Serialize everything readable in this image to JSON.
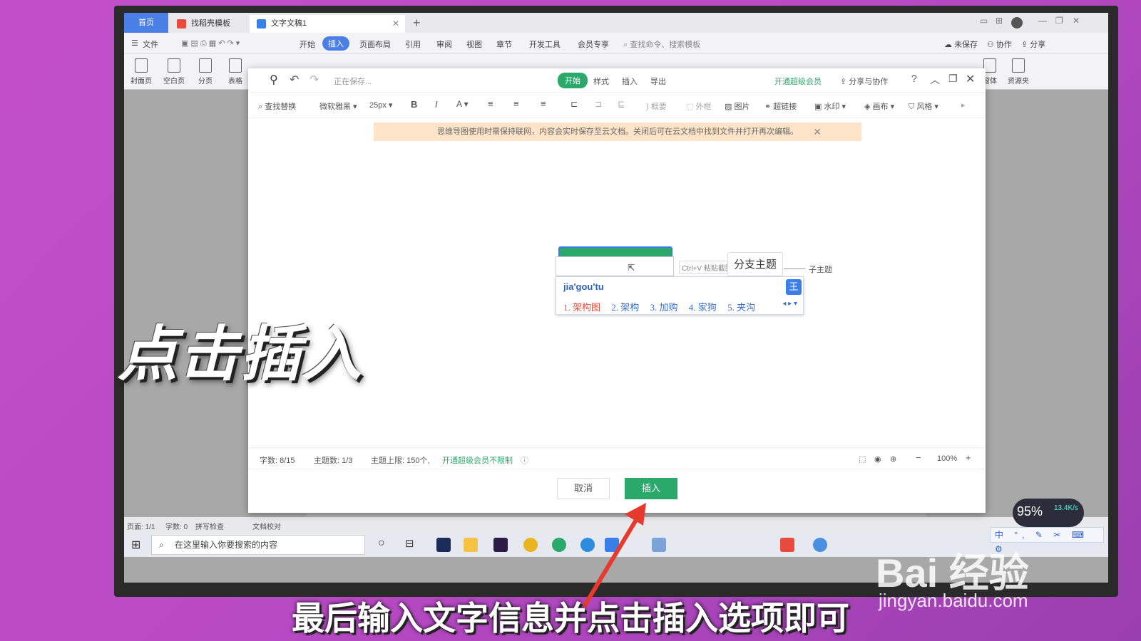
{
  "tabs": [
    {
      "label": "首页"
    },
    {
      "label": "找稻壳模板"
    },
    {
      "label": "文字文稿1"
    }
  ],
  "menu": [
    "文件",
    "开始",
    "插入",
    "页面布局",
    "引用",
    "审阅",
    "视图",
    "章节",
    "开发工具",
    "会员专享"
  ],
  "menu_search": "查找命令、搜索模板",
  "menu_right": [
    "未保存",
    "协作",
    "分享"
  ],
  "ribbon": [
    "封面页",
    "空白页",
    "分页",
    "表格",
    "窗体",
    "资源夹"
  ],
  "dialog": {
    "saving": "正在保存...",
    "tabs": [
      "开始",
      "样式",
      "插入",
      "导出"
    ],
    "member": "开通超级会员",
    "share": "分享与协作",
    "toolbar": {
      "find": "查找替换",
      "font": "微软雅黑",
      "size": "25px",
      "summary": "概要",
      "frame": "外框",
      "image": "图片",
      "link": "超链接",
      "watermark": "水印",
      "canvas": "画布",
      "style": "风格"
    },
    "notice": "思维导图使用时需保持联网，内容会实时保存至云文档。关闭后可在云文档中找到文件并打开再次编辑。",
    "mind": {
      "paste_hint": "Ctrl+V 粘贴截图",
      "branch": "分支主题",
      "sub": "子主题"
    },
    "ime": {
      "input": "jia'gou'tu",
      "logo": "王",
      "candidates": [
        "1. 架构图",
        "2. 架构",
        "3. 加购",
        "4. 家狗",
        "5. 夹沟"
      ]
    },
    "status": {
      "words": "字数: 8/15",
      "topics": "主题数: 1/3",
      "limit": "主题上限: 150个,",
      "upgrade": "开通超级会员不限制",
      "zoom": "100%"
    },
    "cancel": "取消",
    "insert": "插入"
  },
  "statusbar": [
    "页面: 1/1",
    "字数: 0",
    "拼写检查",
    "文档校对"
  ],
  "taskbar": {
    "search_placeholder": "在这里输入你要搜索的内容"
  },
  "net": {
    "percent": "95%",
    "speed": "13.4K/s"
  },
  "ime_tray": "中 °, ✎ ✂ ⌨ ⚙",
  "captions": {
    "big": "点击插入",
    "bottom": "最后输入文字信息并点击插入选项即可"
  },
  "watermark": {
    "brand": "Bai 经验",
    "url": "jingyan.baidu.com"
  },
  "colors": {
    "accent_green": "#2ba96b",
    "wps_blue": "#4a7fe5",
    "background": "#c24fc9"
  }
}
